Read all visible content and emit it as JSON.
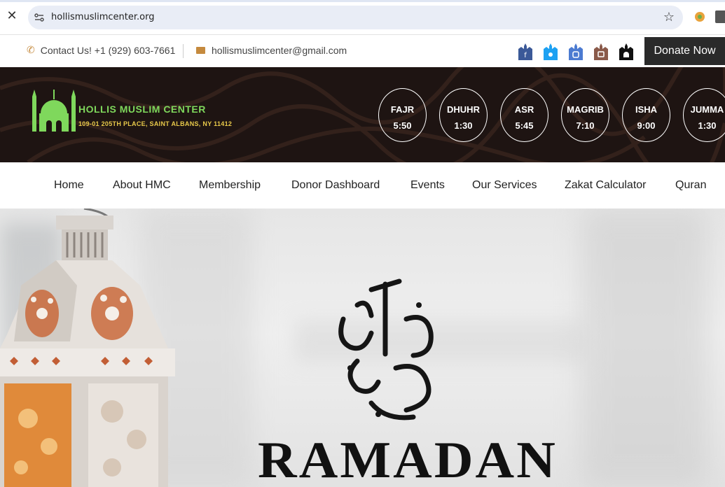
{
  "browser": {
    "url": "hollismuslimcenter.org",
    "icons": [
      "close-icon",
      "site-settings-icon",
      "star-icon",
      "extension-icon",
      "extension-icon"
    ]
  },
  "topbar": {
    "contact_label": "Contact Us! +1 (929) 603-7661",
    "email": "hollismuslimcenter@gmail.com",
    "donate_label": "Donate Now",
    "social_icons": [
      "facebook-icon",
      "twitter-icon",
      "instagram-icon",
      "youtube-icon",
      "mosque-icon"
    ]
  },
  "header": {
    "brand_name": "HOLLIS MUSLIM CENTER",
    "address": "109-01 205TH PLACE, SAINT ALBANS, NY 11412",
    "prayers": [
      {
        "name": "FAJR",
        "time": "5:50"
      },
      {
        "name": "DHUHR",
        "time": "1:30"
      },
      {
        "name": "ASR",
        "time": "5:45"
      },
      {
        "name": "MAGRIB",
        "time": "7:10"
      },
      {
        "name": "ISHA",
        "time": "9:00"
      },
      {
        "name": "JUMMA",
        "time": "1:30"
      }
    ]
  },
  "nav": {
    "items": [
      "Home",
      "About HMC",
      "Membership",
      "Donor Dashboard",
      "Events",
      "Our Services",
      "Zakat Calculator",
      "Quran"
    ]
  },
  "hero": {
    "heading": "RAMADAN"
  },
  "colors": {
    "accent_gold": "#c58a3e",
    "logo_green": "#7fd85c",
    "address_yellow": "#e8c94a",
    "header_bg": "#1e1412",
    "donate_bg": "#2a2a2a"
  }
}
